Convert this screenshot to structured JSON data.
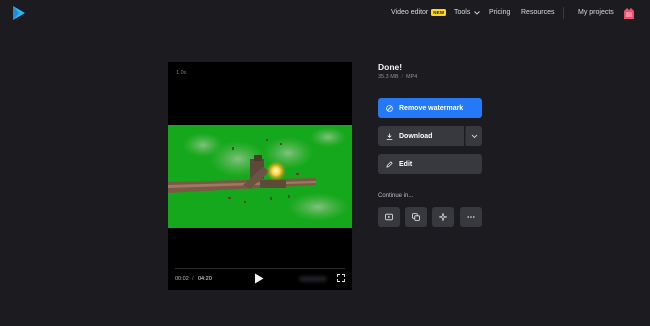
{
  "header": {
    "nav": {
      "video_editor": "Video editor",
      "new_badge": "NEW",
      "tools": "Tools",
      "pricing": "Pricing",
      "resources": "Resources",
      "my_projects": "My projects"
    }
  },
  "player": {
    "speed": "1.0x",
    "current_time": "00:02",
    "separator": "/",
    "total_time": "04:20",
    "progress": 0.008
  },
  "result": {
    "title": "Done!",
    "size": "35.3 MB",
    "separator": "/",
    "format": "MP4"
  },
  "actions": {
    "remove_watermark": "Remove watermark",
    "download": "Download",
    "edit": "Edit"
  },
  "continue": {
    "label": "Continue in...",
    "tools": [
      {
        "icon": "video-player-icon"
      },
      {
        "icon": "merge-icon"
      },
      {
        "icon": "sparkle-icon"
      },
      {
        "icon": "more-icon"
      }
    ]
  },
  "colors": {
    "background": "#1c1c20",
    "accent": "#2579f6",
    "button": "#38383f",
    "badge": "#ffd81b",
    "green_screen": "#16a81c"
  }
}
